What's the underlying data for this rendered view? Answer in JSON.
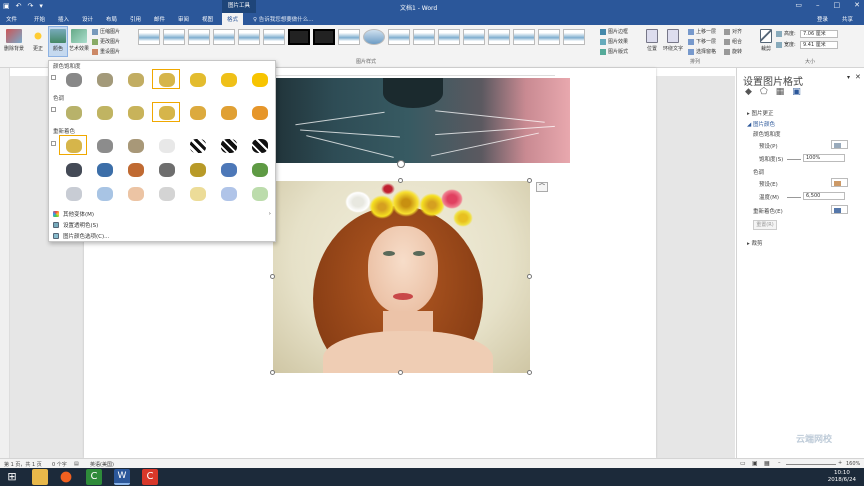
{
  "window": {
    "title": "文档1 - Word",
    "context_tab_group": "图片工具"
  },
  "tabs": [
    "文件",
    "开始",
    "插入",
    "设计",
    "布局",
    "引用",
    "邮件",
    "审阅",
    "视图",
    "格式"
  ],
  "active_tab": "格式",
  "tell_me": "告诉我您想要做什么...",
  "account": {
    "login": "登录",
    "share": "共享"
  },
  "ribbon": {
    "remove_bg": "删除背景",
    "corrections": "更正",
    "color": "颜色",
    "artistic": "艺术效果",
    "compress": "压缩图片",
    "change_pic": "更改图片",
    "reset_pic": "重设图片",
    "style_group": "图片样式",
    "border": "图片边框",
    "effects": "图片效果",
    "layout": "图片版式",
    "position": "位置",
    "wrap": "环绕文字",
    "bring_forward": "上移一层",
    "send_backward": "下移一层",
    "selection_pane": "选择窗格",
    "align": "对齐",
    "group": "组合",
    "rotate": "旋转",
    "arrange_group": "排列",
    "crop": "裁剪",
    "height_label": "高度:",
    "height": "7.06 厘米",
    "width_label": "宽度:",
    "width": "9.41 厘米",
    "size_group": "大小"
  },
  "color_menu": {
    "section1": "颜色饱和度",
    "section2": "色调",
    "section3": "重新着色",
    "more_variants": "其他变体(M)",
    "set_transparent": "设置透明色(S)",
    "options": "图片颜色选项(C)..."
  },
  "pane": {
    "title": "设置图片格式",
    "correction": "图片更正",
    "color": "图片颜色",
    "saturation_section": "颜色饱和度",
    "preset1": "预设(P)",
    "saturation_label": "饱和度(S)",
    "saturation_value": "100%",
    "tone_section": "色调",
    "preset2": "预设(E)",
    "temperature_label": "温度(M)",
    "temperature_value": "6,500",
    "recolor_label": "重新着色(E)",
    "reset_btn": "重置(R)",
    "crop": "裁剪"
  },
  "status": {
    "page": "第 1 页，共 1 页",
    "words": "0 个字",
    "lang": "英语(美国)",
    "zoom": "160%"
  },
  "clock": {
    "time": "10:10",
    "date": "2018/6/24"
  },
  "watermark": "云端网校"
}
